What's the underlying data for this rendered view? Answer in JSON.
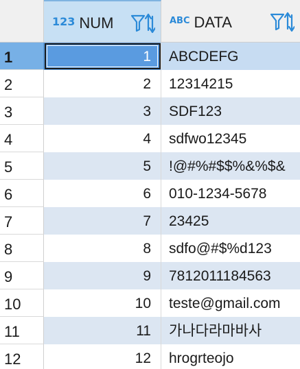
{
  "grid": {
    "columns": [
      {
        "type_badge": "123",
        "name": "NUM"
      },
      {
        "type_badge": "ABC",
        "name": "DATA"
      }
    ],
    "rows": [
      {
        "rownum": "1",
        "num": "1",
        "data": "ABCDEFG"
      },
      {
        "rownum": "2",
        "num": "2",
        "data": "12314215"
      },
      {
        "rownum": "3",
        "num": "3",
        "data": "SDF123"
      },
      {
        "rownum": "4",
        "num": "4",
        "data": "sdfwo12345"
      },
      {
        "rownum": "5",
        "num": "5",
        "data": "!@#%#$$%&%$&"
      },
      {
        "rownum": "6",
        "num": "6",
        "data": "010-1234-5678"
      },
      {
        "rownum": "7",
        "num": "7",
        "data": "23425"
      },
      {
        "rownum": "8",
        "num": "8",
        "data": "sdfo@#$%d123"
      },
      {
        "rownum": "9",
        "num": "9",
        "data": "7812011184563"
      },
      {
        "rownum": "10",
        "num": "10",
        "data": "teste@gmail.com"
      },
      {
        "rownum": "11",
        "num": "11",
        "data": "가나다라마바사"
      },
      {
        "rownum": "12",
        "num": "12",
        "data": "hrogrteojo"
      }
    ]
  },
  "colors": {
    "accent": "#2b8ad8",
    "selected_cell": "#5a9be0",
    "selected_rownum": "#77b0e6",
    "stripe": "#dce6f2",
    "header_bg": "#f0f0f0",
    "active_header_bg": "#c7e0f4"
  },
  "icons": {
    "filter": "filter-icon",
    "sort": "sort-icon"
  }
}
